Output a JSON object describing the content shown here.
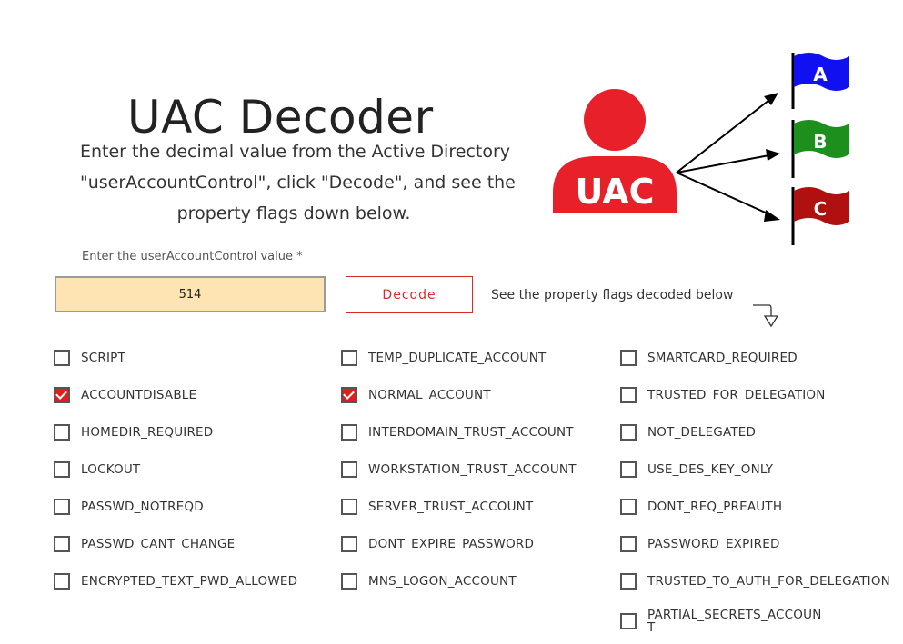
{
  "header": {
    "title": "UAC Decoder",
    "intro_lines": [
      "Enter the decimal value from the Active Directory",
      "\"userAccountControl\", click \"Decode\", and see the",
      "property flags down below."
    ]
  },
  "illustration": {
    "badge_text": "UAC",
    "flags": [
      "A",
      "B",
      "C"
    ],
    "colors": {
      "person": "#e8202a",
      "flag_a": "#1010f0",
      "flag_b": "#1c8f1c",
      "flag_c": "#b01010"
    }
  },
  "form": {
    "label": "Enter the userAccountControl value *",
    "value": "514",
    "decode_label": "Decode",
    "hint": "See the property flags decoded below"
  },
  "flags": {
    "col1": [
      {
        "label": "SCRIPT",
        "checked": false
      },
      {
        "label": "ACCOUNTDISABLE",
        "checked": true
      },
      {
        "label": "HOMEDIR_REQUIRED",
        "checked": false
      },
      {
        "label": "LOCKOUT",
        "checked": false
      },
      {
        "label": "PASSWD_NOTREQD",
        "checked": false
      },
      {
        "label": "PASSWD_CANT_CHANGE",
        "checked": false
      },
      {
        "label": "ENCRYPTED_TEXT_PWD_ALLOWED",
        "checked": false
      }
    ],
    "col2": [
      {
        "label": "TEMP_DUPLICATE_ACCOUNT",
        "checked": false
      },
      {
        "label": "NORMAL_ACCOUNT",
        "checked": true
      },
      {
        "label": "INTERDOMAIN_TRUST_ACCOUNT",
        "checked": false
      },
      {
        "label": "WORKSTATION_TRUST_ACCOUNT",
        "checked": false
      },
      {
        "label": "SERVER_TRUST_ACCOUNT",
        "checked": false
      },
      {
        "label": "DONT_EXPIRE_PASSWORD",
        "checked": false
      },
      {
        "label": "MNS_LOGON_ACCOUNT",
        "checked": false
      }
    ],
    "col3": [
      {
        "label": "SMARTCARD_REQUIRED",
        "checked": false
      },
      {
        "label": "TRUSTED_FOR_DELEGATION",
        "checked": false
      },
      {
        "label": "NOT_DELEGATED",
        "checked": false
      },
      {
        "label": "USE_DES_KEY_ONLY",
        "checked": false
      },
      {
        "label": "DONT_REQ_PREAUTH",
        "checked": false
      },
      {
        "label": "PASSWORD_EXPIRED",
        "checked": false
      },
      {
        "label": "TRUSTED_TO_AUTH_FOR_DELEGATION",
        "checked": false
      },
      {
        "label": "PARTIAL_SECRETS_ACCOUNT",
        "checked": false
      }
    ]
  }
}
